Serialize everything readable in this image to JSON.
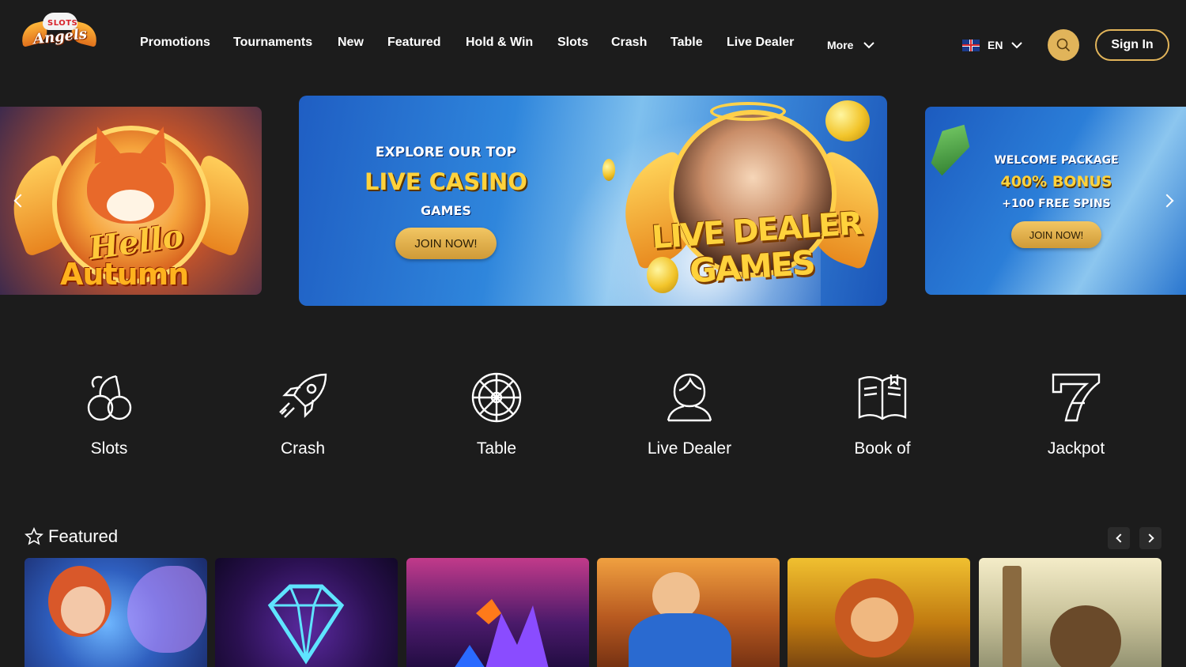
{
  "header": {
    "logo_top": "SLOTS",
    "logo_main": "Angels",
    "nav": [
      "Promotions",
      "Tournaments",
      "New",
      "Featured",
      "Hold & Win",
      "Slots",
      "Crash",
      "Table",
      "Live Dealer"
    ],
    "more_label": "More",
    "language": "EN",
    "signin_label": "Sign In",
    "accent_color": "#e1b45a"
  },
  "carousel": {
    "left": {
      "line1": "Hello",
      "line2": "Autumn"
    },
    "main": {
      "line1": "EXPLORE OUR TOP",
      "line2": "LIVE CASINO",
      "line3": "GAMES",
      "button": "JOIN NOW!",
      "art_line1": "LIVE DEALER",
      "art_line2": "GAMES"
    },
    "right": {
      "line1": "WELCOME PACKAGE",
      "line2": "400% BONUS",
      "line3": "+100 FREE SPINS",
      "button": "JOIN NOW!"
    }
  },
  "categories": [
    {
      "label": "Slots",
      "icon": "cherries-icon"
    },
    {
      "label": "Crash",
      "icon": "rocket-icon"
    },
    {
      "label": "Table",
      "icon": "roulette-icon"
    },
    {
      "label": "Live Dealer",
      "icon": "dealer-icon"
    },
    {
      "label": "Book of",
      "icon": "book-icon"
    },
    {
      "label": "Jackpot",
      "icon": "seven-icon"
    }
  ],
  "featured": {
    "title": "Featured",
    "icon": "star-icon"
  }
}
